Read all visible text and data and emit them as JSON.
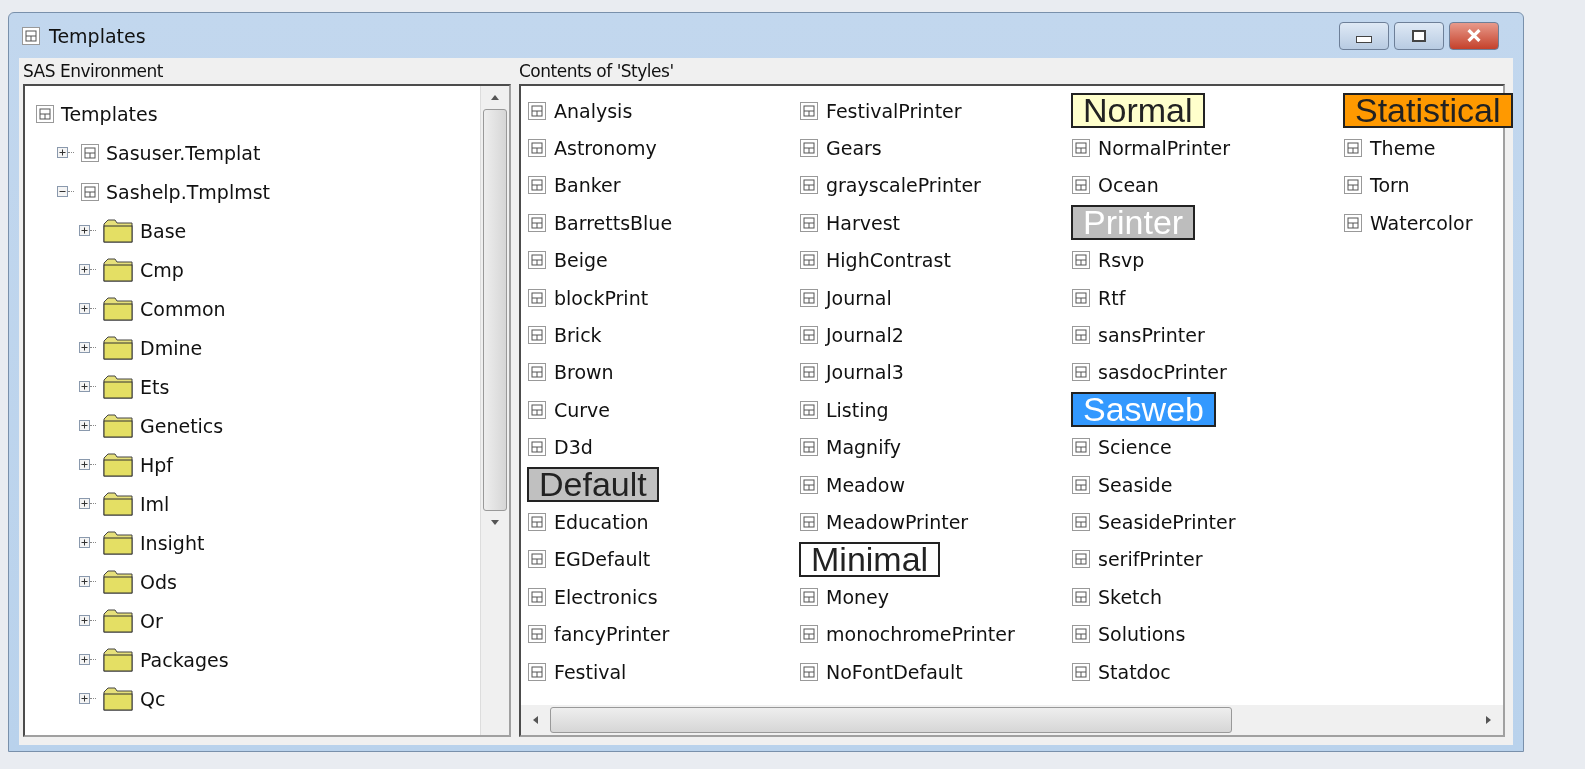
{
  "window": {
    "title": "Templates"
  },
  "left_panel": {
    "title": "SAS Environment",
    "tree": [
      {
        "label": "Templates",
        "kind": "template",
        "children": [
          {
            "label": "Sasuser.Templat",
            "kind": "template",
            "expanded": false
          },
          {
            "label": "Sashelp.Tmplmst",
            "kind": "template",
            "expanded": true,
            "children": [
              {
                "label": "Base",
                "kind": "folder",
                "expanded": false
              },
              {
                "label": "Cmp",
                "kind": "folder",
                "expanded": false
              },
              {
                "label": "Common",
                "kind": "folder",
                "expanded": false
              },
              {
                "label": "Dmine",
                "kind": "folder",
                "expanded": false
              },
              {
                "label": "Ets",
                "kind": "folder",
                "expanded": false
              },
              {
                "label": "Genetics",
                "kind": "folder",
                "expanded": false
              },
              {
                "label": "Hpf",
                "kind": "folder",
                "expanded": false
              },
              {
                "label": "Iml",
                "kind": "folder",
                "expanded": false
              },
              {
                "label": "Insight",
                "kind": "folder",
                "expanded": false
              },
              {
                "label": "Ods",
                "kind": "folder",
                "expanded": false
              },
              {
                "label": "Or",
                "kind": "folder",
                "expanded": false
              },
              {
                "label": "Packages",
                "kind": "folder",
                "expanded": false
              },
              {
                "label": "Qc",
                "kind": "folder",
                "expanded": false
              }
            ]
          }
        ]
      }
    ]
  },
  "right_panel": {
    "title": "Contents of 'Styles'",
    "items": [
      {
        "label": "Analysis",
        "kind": "item"
      },
      {
        "label": "Astronomy",
        "kind": "item"
      },
      {
        "label": "Banker",
        "kind": "item"
      },
      {
        "label": "BarrettsBlue",
        "kind": "item"
      },
      {
        "label": "Beige",
        "kind": "item"
      },
      {
        "label": "blockPrint",
        "kind": "item"
      },
      {
        "label": "Brick",
        "kind": "item"
      },
      {
        "label": "Brown",
        "kind": "item"
      },
      {
        "label": "Curve",
        "kind": "item"
      },
      {
        "label": "D3d",
        "kind": "item"
      },
      {
        "label": "Default",
        "kind": "callout",
        "color": "#c0c0c0",
        "light_text": false
      },
      {
        "label": "Education",
        "kind": "item"
      },
      {
        "label": "EGDefault",
        "kind": "item"
      },
      {
        "label": "Electronics",
        "kind": "item"
      },
      {
        "label": "fancyPrinter",
        "kind": "item"
      },
      {
        "label": "Festival",
        "kind": "item"
      },
      {
        "label": "FestivalPrinter",
        "kind": "item"
      },
      {
        "label": "Gears",
        "kind": "item"
      },
      {
        "label": "grayscalePrinter",
        "kind": "item"
      },
      {
        "label": "Harvest",
        "kind": "item"
      },
      {
        "label": "HighContrast",
        "kind": "item"
      },
      {
        "label": "Journal",
        "kind": "item"
      },
      {
        "label": "Journal2",
        "kind": "item"
      },
      {
        "label": "Journal3",
        "kind": "item"
      },
      {
        "label": "Listing",
        "kind": "item"
      },
      {
        "label": "Magnify",
        "kind": "item"
      },
      {
        "label": "Meadow",
        "kind": "item"
      },
      {
        "label": "MeadowPrinter",
        "kind": "item"
      },
      {
        "label": "Minimal",
        "kind": "callout",
        "color": "#ffffff",
        "light_text": false
      },
      {
        "label": "Money",
        "kind": "item"
      },
      {
        "label": "monochromePrinter",
        "kind": "item"
      },
      {
        "label": "NoFontDefault",
        "kind": "item"
      },
      {
        "label": "Normal",
        "kind": "callout",
        "color": "#ffffcc",
        "light_text": false
      },
      {
        "label": "NormalPrinter",
        "kind": "item"
      },
      {
        "label": "Ocean",
        "kind": "item"
      },
      {
        "label": "Printer",
        "kind": "callout",
        "color": "#bdbdbd",
        "light_text": true
      },
      {
        "label": "Rsvp",
        "kind": "item"
      },
      {
        "label": "Rtf",
        "kind": "item"
      },
      {
        "label": "sansPrinter",
        "kind": "item"
      },
      {
        "label": "sasdocPrinter",
        "kind": "item"
      },
      {
        "label": "Sasweb",
        "kind": "callout",
        "color": "#3399ff",
        "light_text": true
      },
      {
        "label": "Science",
        "kind": "item"
      },
      {
        "label": "Seaside",
        "kind": "item"
      },
      {
        "label": "SeasidePrinter",
        "kind": "item"
      },
      {
        "label": "serifPrinter",
        "kind": "item"
      },
      {
        "label": "Sketch",
        "kind": "item"
      },
      {
        "label": "Solutions",
        "kind": "item"
      },
      {
        "label": "Statdoc",
        "kind": "item"
      },
      {
        "label": "Statistical",
        "kind": "callout",
        "color": "#ff9900",
        "light_text": false
      },
      {
        "label": "Theme",
        "kind": "item"
      },
      {
        "label": "Torn",
        "kind": "item"
      },
      {
        "label": "Watercolor",
        "kind": "item"
      }
    ]
  }
}
